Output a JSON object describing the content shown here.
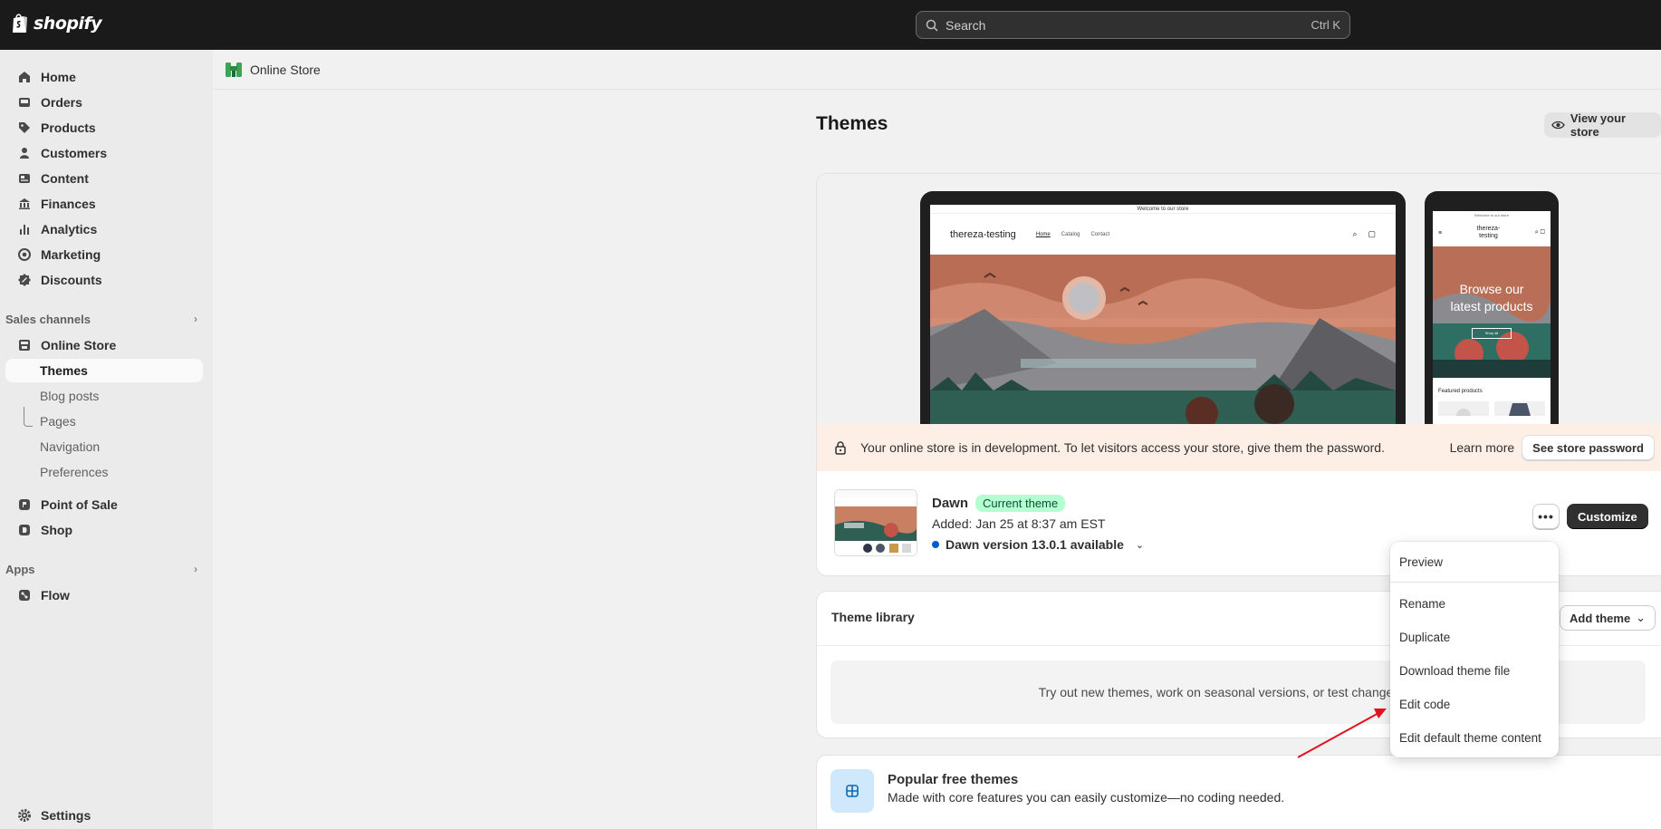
{
  "app": {
    "logo_text": "shopify"
  },
  "search": {
    "placeholder": "Search",
    "shortcut": "Ctrl K"
  },
  "sidebar": {
    "main_items": [
      {
        "label": "Home",
        "icon": "home-icon"
      },
      {
        "label": "Orders",
        "icon": "inbox-icon"
      },
      {
        "label": "Products",
        "icon": "tag-icon"
      },
      {
        "label": "Customers",
        "icon": "person-icon"
      },
      {
        "label": "Content",
        "icon": "content-icon"
      },
      {
        "label": "Finances",
        "icon": "bank-icon"
      },
      {
        "label": "Analytics",
        "icon": "bar-chart-icon"
      },
      {
        "label": "Marketing",
        "icon": "target-icon"
      },
      {
        "label": "Discounts",
        "icon": "discount-icon"
      }
    ],
    "sales_channels_label": "Sales channels",
    "online_store_label": "Online Store",
    "online_store_sub": [
      "Themes",
      "Blog posts",
      "Pages",
      "Navigation",
      "Preferences"
    ],
    "point_of_sale_label": "Point of Sale",
    "shop_label": "Shop",
    "apps_label": "Apps",
    "flow_label": "Flow",
    "settings_label": "Settings"
  },
  "breadcrumb": {
    "label": "Online Store"
  },
  "page": {
    "title": "Themes",
    "view_store_label": "View your store"
  },
  "preview": {
    "laptop": {
      "banner": "Welcome to our store",
      "brand": "thereza-testing",
      "nav": [
        "Home",
        "Catalog",
        "Contact"
      ]
    },
    "phone": {
      "banner": "Welcome to our store",
      "brand_line1": "thereza-",
      "brand_line2": "testing",
      "hero_line1": "Browse our",
      "hero_line2": "latest products",
      "hero_button": "Shop all",
      "featured": "Featured products"
    }
  },
  "dev_banner": {
    "text": "Your online store is in development. To let visitors access your store, give them the password.",
    "learn_more": "Learn more",
    "button": "See store password"
  },
  "current_theme": {
    "name": "Dawn",
    "badge": "Current theme",
    "added": "Added: Jan 25 at 8:37 am EST",
    "version": "Dawn version 13.0.1 available",
    "more_label": "•••",
    "customize_label": "Customize"
  },
  "theme_library": {
    "title": "Theme library",
    "add_theme_label": "Add theme",
    "empty_text": "Try out new themes, work on seasonal versions, or test changes to you"
  },
  "popular": {
    "title": "Popular free themes",
    "subtitle": "Made with core features you can easily customize—no coding needed."
  },
  "menu": {
    "items": [
      "Preview",
      "Rename",
      "Duplicate",
      "Download theme file",
      "Edit code",
      "Edit default theme content"
    ]
  },
  "colors": {
    "topbar": "#1a1a1a",
    "badge_bg": "#b4fed2",
    "dev_banner_bg": "#fdeee6",
    "annotation_arrow": "#e0141e",
    "version_dot": "#005bd3"
  }
}
